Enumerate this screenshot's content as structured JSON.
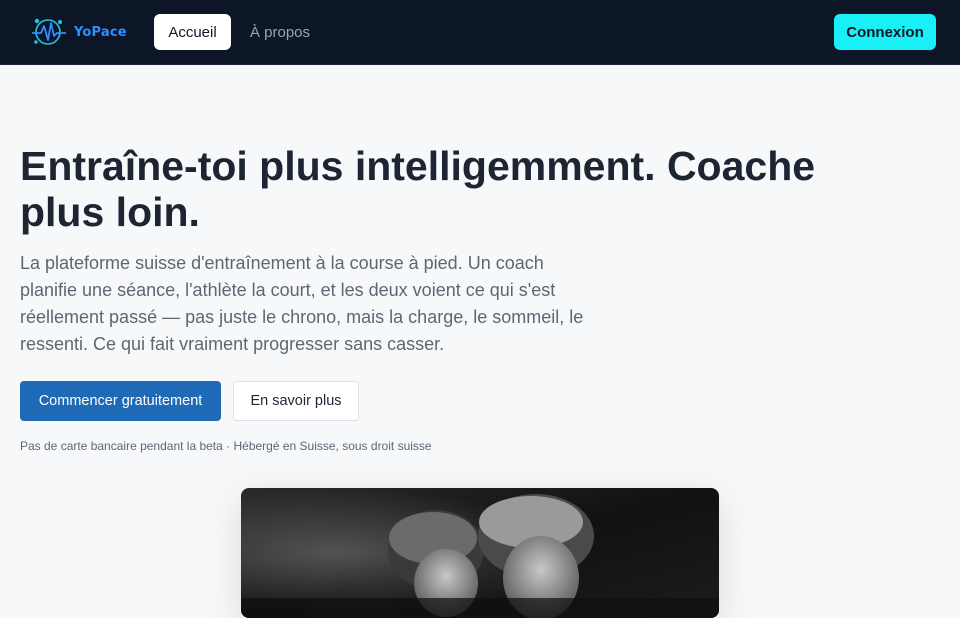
{
  "nav": {
    "logo_text": "YoPace",
    "home_label": "Accueil",
    "about_label": "À propos",
    "login_label": "Connexion"
  },
  "hero": {
    "title": "Entraîne-toi plus intelligemment. Coache plus loin.",
    "subtitle": "La plateforme suisse d'entraînement à la course à pied. Un coach planifie une séance, l'athlète la court, et les deux voient ce qui s'est réellement passé — pas juste le chrono, mais la charge, le sommeil, le ressenti. Ce qui fait vraiment progresser sans casser.",
    "cta_primary": "Commencer gratuitement",
    "cta_secondary": "En savoir plus",
    "fineprint": "Pas de carte bancaire pendant la beta · Hébergé en Suisse, sous droit suisse"
  },
  "colors": {
    "nav_bg": "#0d1626",
    "accent_cyan": "#19f0f6",
    "primary_blue": "#1e6ab7",
    "page_bg": "#f6f8fa"
  },
  "icons": {
    "logo": "heartbeat-pulse-logo-icon"
  }
}
